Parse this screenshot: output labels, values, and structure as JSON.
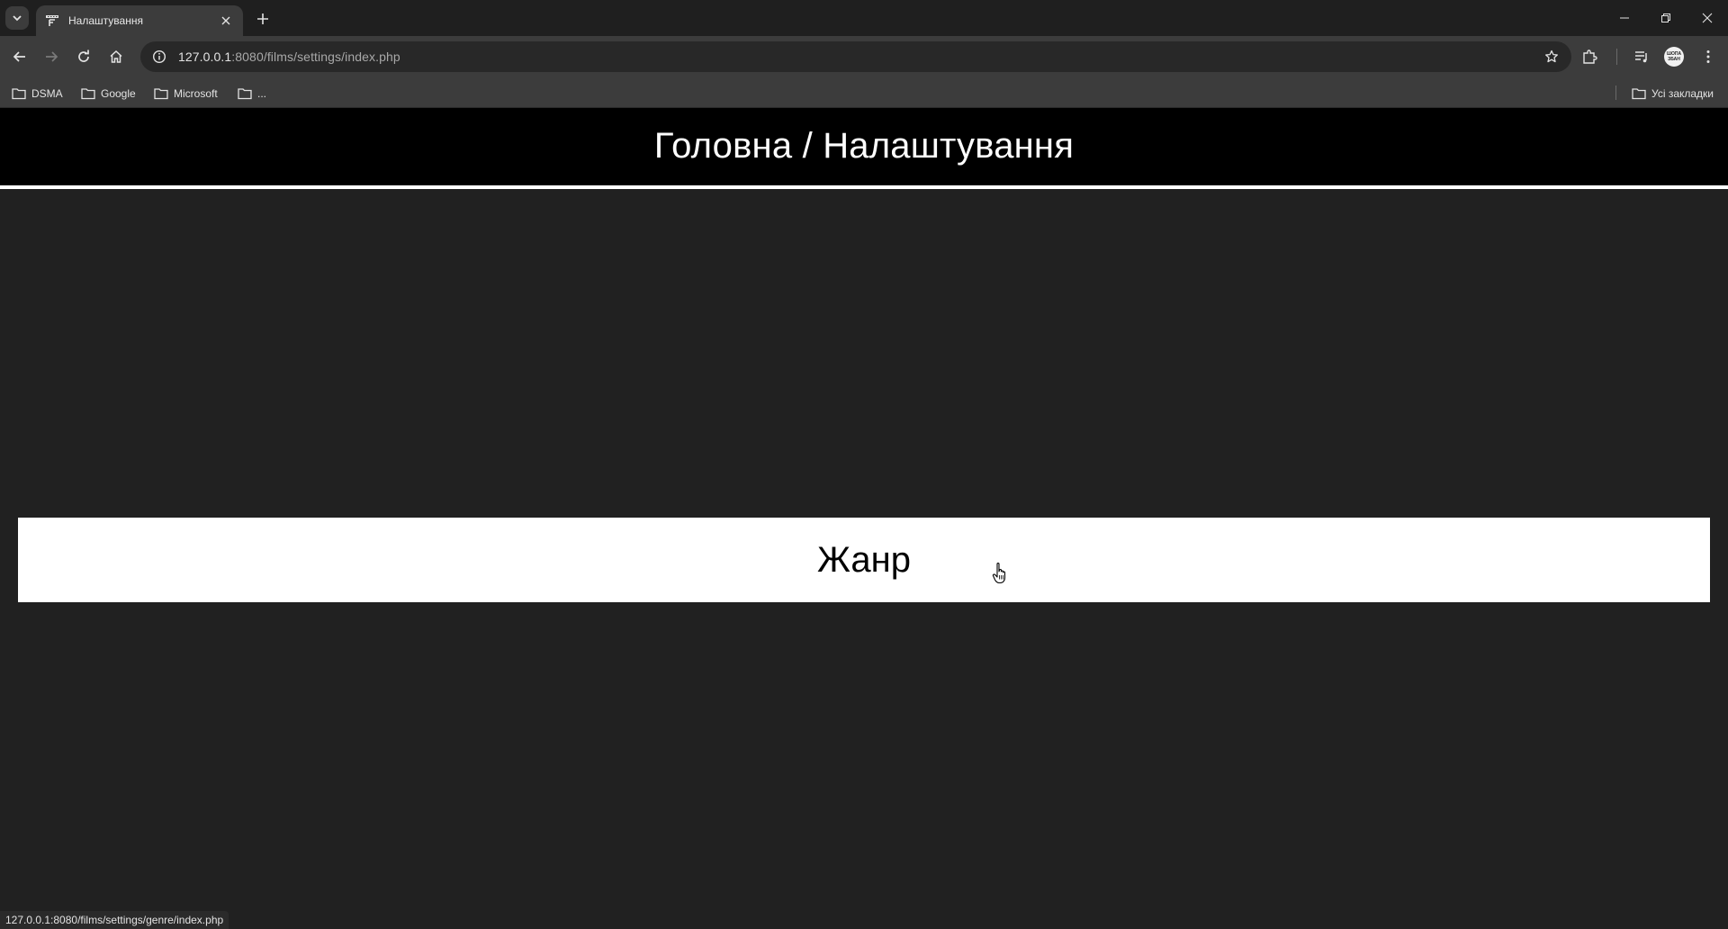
{
  "browser": {
    "tab": {
      "title": "Налаштування"
    },
    "address": {
      "host": "127.0.0.1",
      "rest": ":8080/films/settings/index.php"
    },
    "bookmarks": [
      "DSMA",
      "Google",
      "Microsoft",
      "..."
    ],
    "all_bookmarks_label": "Усі закладки",
    "avatar_text": "ШОПА ЗБАН",
    "status_url": "127.0.0.1:8080/films/settings/genre/index.php"
  },
  "page": {
    "header_title": "Головна / Налаштування",
    "genre_link": "Жанр"
  },
  "icons": {
    "tab_list": "chevron-down-icon",
    "favicon": "film-icon",
    "tab_close": "close-icon",
    "new_tab": "plus-icon",
    "back": "arrow-left-icon",
    "forward": "arrow-right-icon",
    "reload": "reload-icon",
    "home": "home-icon",
    "site_info": "info-icon",
    "bookmark_star": "star-icon",
    "extensions": "puzzle-icon",
    "media": "media-queue-icon",
    "menu": "kebab-menu-icon",
    "folder": "folder-icon",
    "pointer": "hand-pointer-icon"
  },
  "colors": {
    "page_bg": "#212121",
    "header_bg": "#000000",
    "card_bg": "#ffffff",
    "chrome_bg": "#3c3c3c"
  }
}
